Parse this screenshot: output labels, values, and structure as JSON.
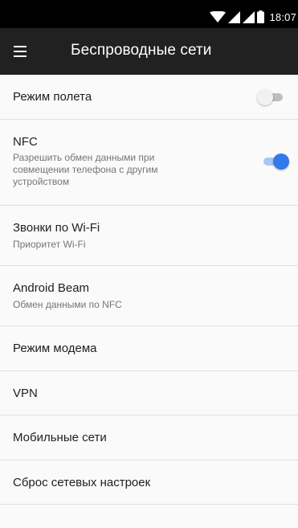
{
  "status_bar": {
    "time": "18:07",
    "icons": [
      "wifi-icon",
      "signal-icon",
      "signal-icon",
      "battery-icon"
    ]
  },
  "app_bar": {
    "menu_icon": "menu-icon",
    "title": "Беспроводные сети"
  },
  "settings": {
    "airplane": {
      "title": "Режим полета",
      "enabled": false
    },
    "nfc": {
      "title": "NFC",
      "summary": "Разрешить обмен данными при совмещении телефона с другим устройством",
      "enabled": true
    },
    "wifi_calling": {
      "title": "Звонки по Wi-Fi",
      "summary": "Приоритет Wi-Fi"
    },
    "android_beam": {
      "title": "Android Beam",
      "summary": "Обмен данными по NFC"
    },
    "tethering": {
      "title": "Режим модема"
    },
    "vpn": {
      "title": "VPN"
    },
    "mobile_networks": {
      "title": "Мобильные сети"
    },
    "network_reset": {
      "title": "Сброс сетевых настроек"
    }
  },
  "colors": {
    "app_bar": "#212121",
    "accent": "#3479ec",
    "background": "#fafafa",
    "divider": "#e0e0e0"
  }
}
